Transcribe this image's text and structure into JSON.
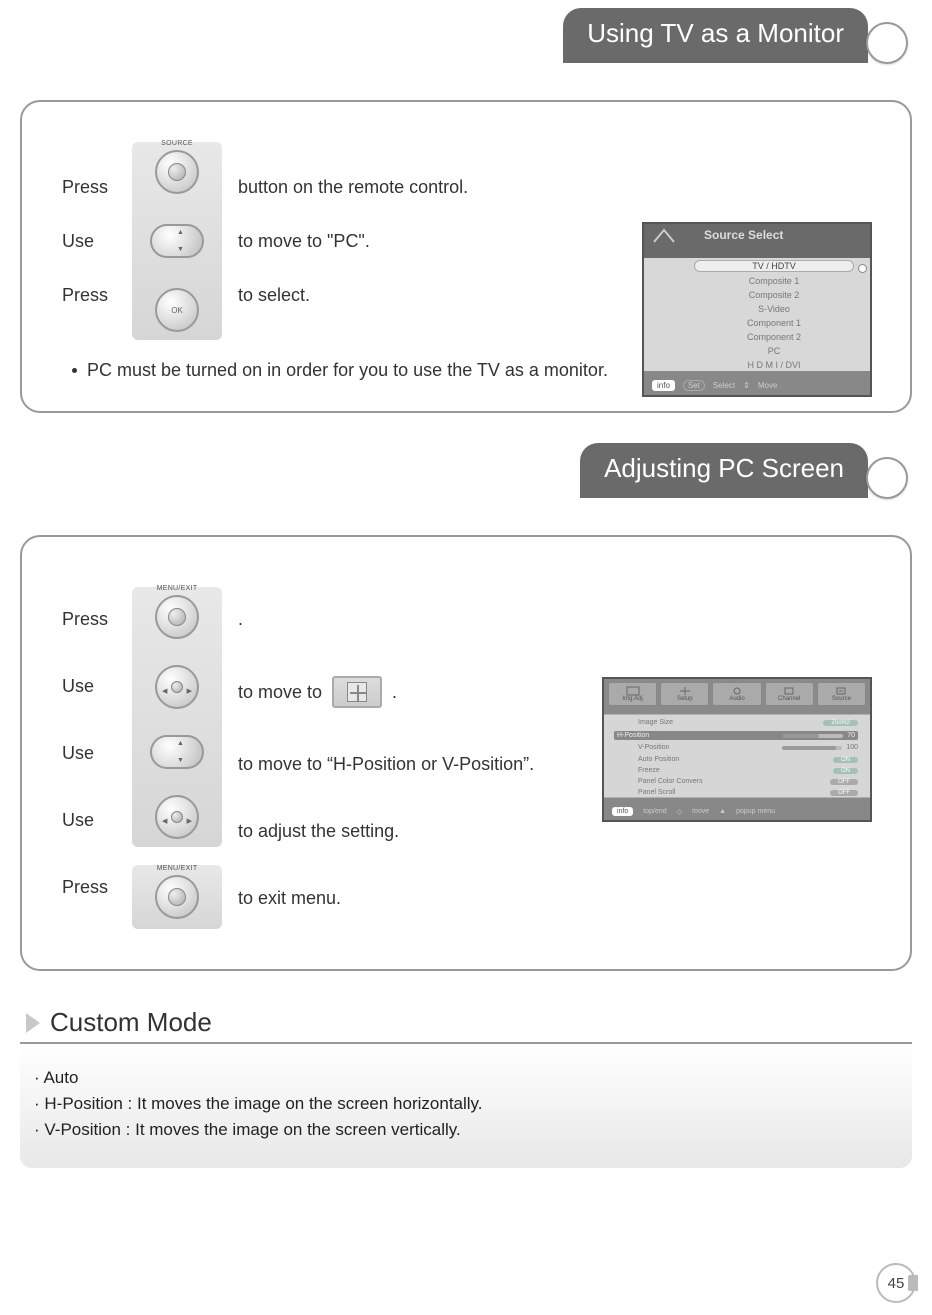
{
  "section1": {
    "title": "Using TV as a Monitor",
    "steps": [
      {
        "verb": "Press",
        "button": "source",
        "buttonLabel": "SOURCE",
        "desc": "button on the remote control."
      },
      {
        "verb": "Use",
        "button": "updown",
        "desc": "to move to  \"PC\"."
      },
      {
        "verb": "Press",
        "button": "ok",
        "desc": "to select."
      }
    ],
    "note": "PC must be turned on in order for you to use the TV as a monitor.",
    "osd": {
      "title": "Source Select",
      "items": [
        "TV / HDTV",
        "Composite 1",
        "Composite 2",
        "S-Video",
        "Component 1",
        "Component 2",
        "PC",
        "H D M I / DVI"
      ],
      "footer": {
        "info": "info",
        "set": "Set",
        "select": "Select",
        "move": "Move"
      }
    }
  },
  "section2": {
    "title": "Adjusting PC Screen",
    "steps": [
      {
        "verb": "Press",
        "button": "menu",
        "buttonLabel": "MENU/EXIT",
        "desc": "."
      },
      {
        "verb": "Use",
        "button": "leftright",
        "desc_pre": "to move to",
        "desc_icon": "imgadj",
        "desc_post": "."
      },
      {
        "verb": "Use",
        "button": "updown",
        "desc": "to move to “H-Position or V-Position”."
      },
      {
        "verb": "Use",
        "button": "leftright",
        "desc": "to adjust the setting."
      },
      {
        "verb": "Press",
        "button": "menu",
        "buttonLabel": "MENU/EXIT",
        "desc": "to exit menu."
      }
    ],
    "osd": {
      "tabs": [
        "Img.Adj",
        "Setup",
        "Audio",
        "Channel",
        "Source"
      ],
      "items": [
        {
          "name": "Image Size",
          "value": "Zoom2",
          "pill": true
        },
        {
          "name": "H-Position",
          "value": "70",
          "highlight": true,
          "bar": true
        },
        {
          "name": "V-Position",
          "value": "100",
          "bar": true
        },
        {
          "name": "Auto Position",
          "value": "ON",
          "pill": true
        },
        {
          "name": "Freeze",
          "value": "ON",
          "pill": true
        },
        {
          "name": "Panel Color Convers",
          "value": "OFF",
          "pill": true,
          "grey": true
        },
        {
          "name": "Panel Scroll",
          "value": "OFF",
          "pill": true,
          "grey": true
        }
      ],
      "footer": {
        "info": "info",
        "hints": [
          "top/end",
          "move",
          "popup menu"
        ]
      }
    }
  },
  "custom": {
    "heading": "Custom Mode",
    "lines": [
      "Auto",
      "H-Position : It moves the image on the screen horizontally.",
      "V-Position : It moves the image on the screen vertically."
    ]
  },
  "page": "45"
}
